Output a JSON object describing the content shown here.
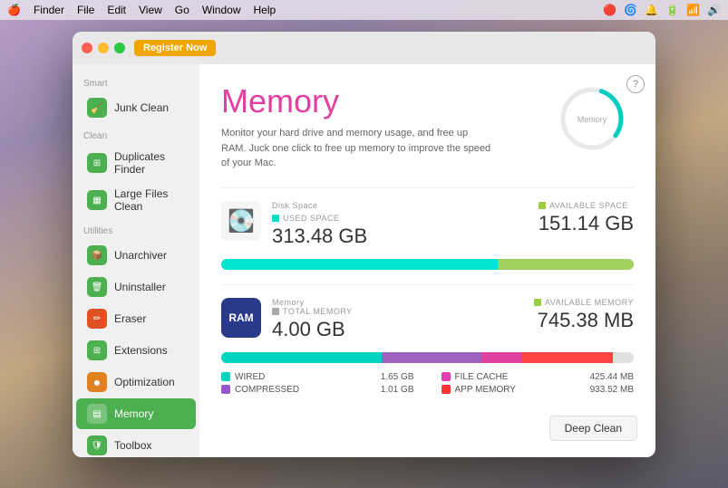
{
  "menubar": {
    "apple": "🍎",
    "items": [
      "Finder",
      "File",
      "Edit",
      "View",
      "Go",
      "Window",
      "Help"
    ]
  },
  "window": {
    "register_button": "Register Now"
  },
  "sidebar": {
    "sections": [
      {
        "label": "Smart",
        "items": [
          {
            "id": "junk-clean",
            "label": "Junk Clean",
            "icon": "🧹",
            "active": false
          }
        ]
      },
      {
        "label": "Clean",
        "items": [
          {
            "id": "duplicates-finder",
            "label": "Duplicates Finder",
            "icon": "⊞",
            "active": false
          },
          {
            "id": "large-files",
            "label": "Large Files Clean",
            "icon": "▦",
            "active": false
          }
        ]
      },
      {
        "label": "Utilities",
        "items": [
          {
            "id": "unarchiver",
            "label": "Unarchiver",
            "icon": "📦",
            "active": false
          },
          {
            "id": "uninstaller",
            "label": "Uninstaller",
            "icon": "🗑",
            "active": false
          },
          {
            "id": "eraser",
            "label": "Eraser",
            "icon": "✏",
            "active": false
          },
          {
            "id": "extensions",
            "label": "Extensions",
            "icon": "⊞",
            "active": false
          },
          {
            "id": "optimization",
            "label": "Optimization",
            "icon": "●",
            "active": false
          },
          {
            "id": "memory",
            "label": "Memory",
            "icon": "▤",
            "active": true
          },
          {
            "id": "toolbox",
            "label": "Toolbox",
            "icon": "🛡",
            "active": false
          }
        ]
      }
    ]
  },
  "content": {
    "help_label": "?",
    "title": "Memory",
    "description": "Monitor your hard drive and memory usage, and free up RAM. Juck one click to free up memory to improve the speed of your Mac.",
    "disk_section": {
      "label": "Disk Space",
      "used_label": "USED SPACE",
      "used_value": "313.48 GB",
      "available_label": "AVAILABLE SPACE",
      "available_value": "151.14 GB",
      "used_color": "#00e0c8",
      "available_color": "#9ece40",
      "used_pct": 67,
      "available_pct": 33
    },
    "memory_section": {
      "label": "Memory",
      "total_label": "TOTAL MEMORY",
      "total_value": "4.00 GB",
      "available_label": "AVAILABLE MEMORY",
      "available_value": "745.38 MB",
      "wired_label": "WIRED",
      "wired_value": "1.65 GB",
      "wired_color": "#00d4c0",
      "compressed_label": "COMPRESSED",
      "compressed_value": "1.01 GB",
      "compressed_color": "#9955cc",
      "file_cache_label": "FILE CACHE",
      "file_cache_value": "425.44 MB",
      "file_cache_color": "#e040b0",
      "app_memory_label": "APP MEMORY",
      "app_memory_value": "933.52 MB",
      "app_memory_color": "#ff3333",
      "wired_pct": 39,
      "compressed_pct": 24,
      "file_cache_pct": 10,
      "app_memory_pct": 22,
      "available_pct": 5
    },
    "gauge": {
      "label": "Memory"
    },
    "deep_clean_label": "Deep Clean"
  }
}
